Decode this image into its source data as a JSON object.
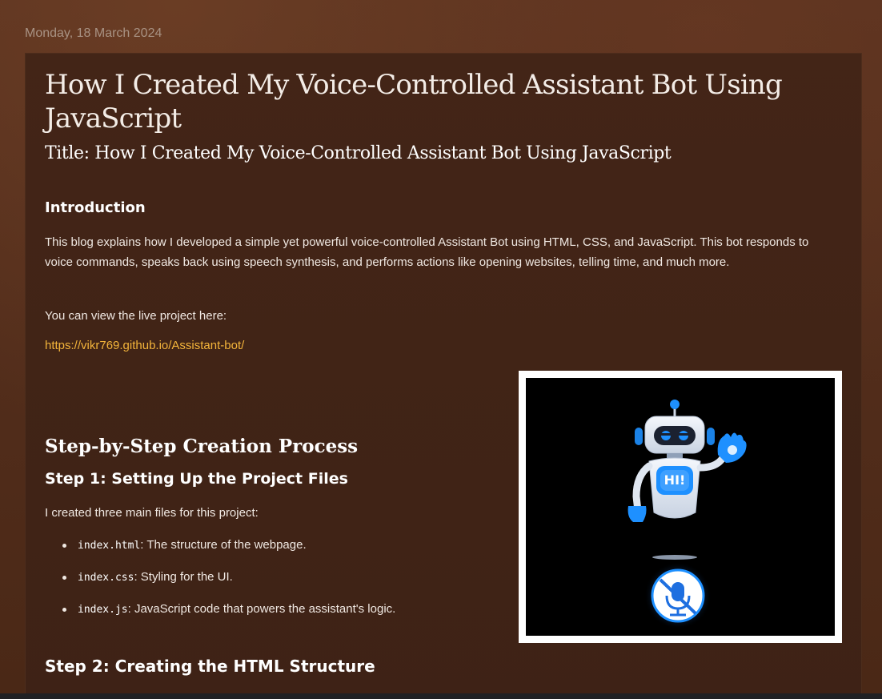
{
  "date_header": "Monday, 18 March 2024",
  "post": {
    "title": "How I Created My Voice-Controlled Assistant Bot Using JavaScript",
    "subtitle": "Title: How I Created My Voice-Controlled Assistant Bot Using JavaScript",
    "intro_heading": "Introduction",
    "intro_paragraph": "This blog explains how I developed a simple yet powerful voice-controlled Assistant Bot using HTML, CSS, and JavaScript. This bot responds to voice commands, speaks back using speech synthesis, and performs actions like opening websites, telling time, and much more.",
    "live_text": "You can view the live project here:",
    "live_link": "https://vikr769.github.io/Assistant-bot/",
    "steps_heading": "Step-by-Step Creation Process",
    "step1_heading": "Step 1: Setting Up the Project Files",
    "step1_text": "I created three main files for this project:",
    "files": [
      {
        "name": "index.html",
        "desc": ": The structure of the webpage."
      },
      {
        "name": "index.css",
        "desc": ": Styling for the UI."
      },
      {
        "name": "index.js",
        "desc": ": JavaScript code that powers the assistant's logic."
      }
    ],
    "step2_heading": "Step 2: Creating the HTML Structure",
    "image": {
      "badge_text": "HI!",
      "colors": {
        "accent": "#1e90ff",
        "robot_body": "#e6ecf5",
        "link": "#f3b43a"
      }
    }
  }
}
